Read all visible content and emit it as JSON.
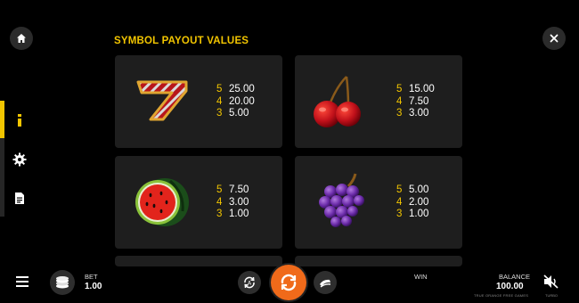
{
  "header": {
    "title": "SYMBOL PAYOUT VALUES"
  },
  "icons": {
    "home": "home-icon",
    "close": "close-icon",
    "info": "info-icon",
    "settings": "gear-icon",
    "document": "document-icon"
  },
  "symbols": [
    {
      "name": "seven",
      "payouts": [
        {
          "count": "5",
          "value": "25.00"
        },
        {
          "count": "4",
          "value": "20.00"
        },
        {
          "count": "3",
          "value": "5.00"
        }
      ]
    },
    {
      "name": "cherry",
      "payouts": [
        {
          "count": "5",
          "value": "15.00"
        },
        {
          "count": "4",
          "value": "7.50"
        },
        {
          "count": "3",
          "value": "3.00"
        }
      ]
    },
    {
      "name": "watermelon",
      "payouts": [
        {
          "count": "5",
          "value": "7.50"
        },
        {
          "count": "4",
          "value": "3.00"
        },
        {
          "count": "3",
          "value": "1.00"
        }
      ]
    },
    {
      "name": "grapes",
      "payouts": [
        {
          "count": "5",
          "value": "5.00"
        },
        {
          "count": "4",
          "value": "2.00"
        },
        {
          "count": "3",
          "value": "1.00"
        }
      ]
    }
  ],
  "bottom": {
    "bet_label": "BET",
    "bet_value": "1.00",
    "win_label": "WIN",
    "balance_label": "BALANCE",
    "balance_value": "100.00",
    "balance_sub": "TRUE ORANGE FREE GAMES",
    "sound_sub": "TURBO"
  },
  "colors": {
    "accent": "#f2c500",
    "spin": "#f06a1a",
    "panel": "#1e1e1e"
  }
}
